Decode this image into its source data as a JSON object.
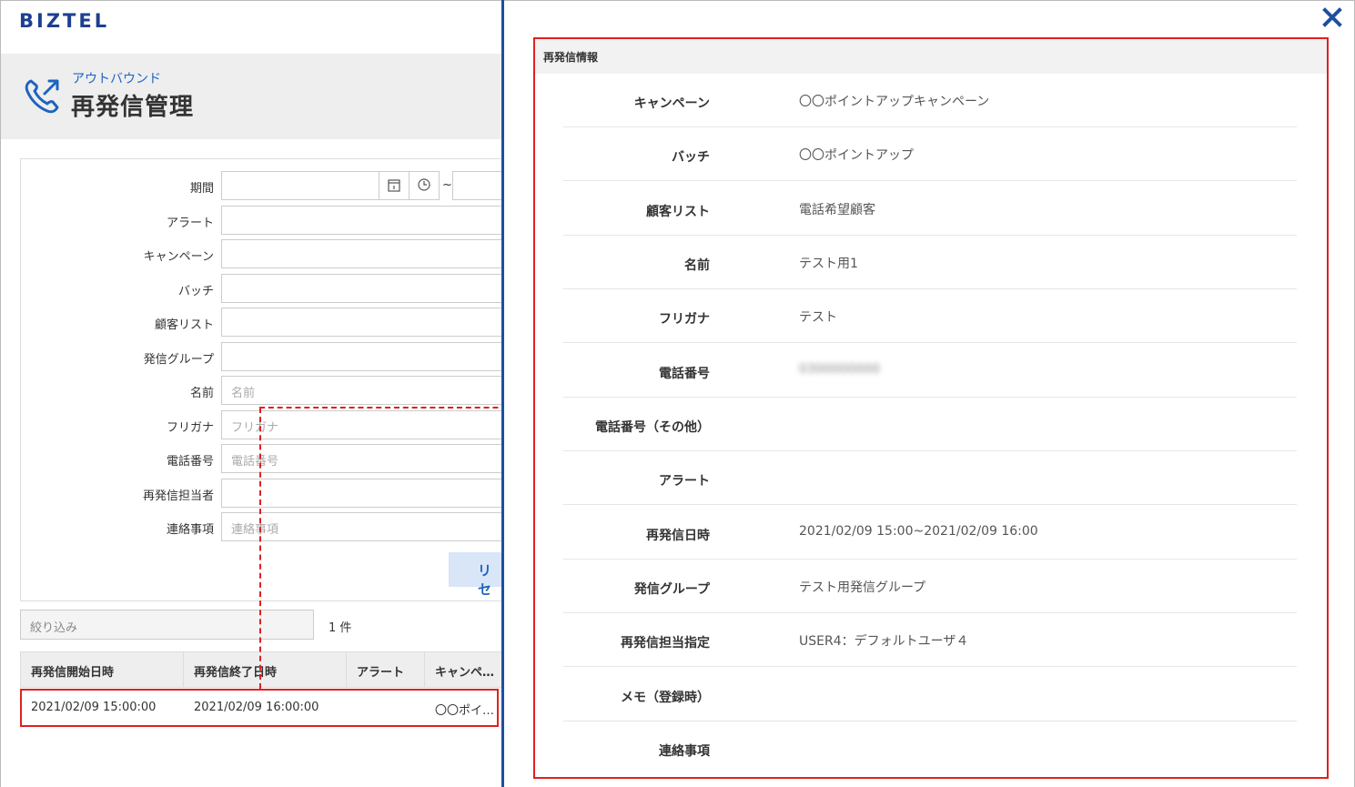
{
  "app": {
    "logo": "BIZTEL",
    "subtitle": "アウトバウンド",
    "title": "再発信管理"
  },
  "filters": {
    "rows": [
      {
        "label": "期間",
        "placeholder": ""
      },
      {
        "label": "アラート",
        "placeholder": ""
      },
      {
        "label": "キャンペーン",
        "placeholder": ""
      },
      {
        "label": "バッチ",
        "placeholder": ""
      },
      {
        "label": "顧客リスト",
        "placeholder": ""
      },
      {
        "label": "発信グループ",
        "placeholder": ""
      },
      {
        "label": "名前",
        "placeholder": "名前"
      },
      {
        "label": "フリガナ",
        "placeholder": "フリガナ"
      },
      {
        "label": "電話番号",
        "placeholder": "電話番号"
      },
      {
        "label": "再発信担当者",
        "placeholder": ""
      },
      {
        "label": "連絡事項",
        "placeholder": "連絡事項"
      }
    ],
    "tilde": "~",
    "reset_label": "リセ"
  },
  "list": {
    "narrow_placeholder": "絞り込み",
    "count": "1 件",
    "columns": [
      "再発信開始日時",
      "再発信終了日時",
      "アラート",
      "キャンペ…"
    ],
    "rows": [
      {
        "start": "2021/02/09 15:00:00",
        "end": "2021/02/09 16:00:00",
        "alert": "",
        "campaign": "〇〇ポイ…"
      }
    ]
  },
  "detail": {
    "heading": "再発信情報",
    "close_icon": "close-icon",
    "fields": [
      {
        "label": "キャンペーン",
        "value": "〇〇ポイントアップキャンペーン"
      },
      {
        "label": "バッチ",
        "value": "〇〇ポイントアップ"
      },
      {
        "label": "顧客リスト",
        "value": "電話希望顧客"
      },
      {
        "label": "名前",
        "value": "テスト用1"
      },
      {
        "label": "フリガナ",
        "value": "テスト"
      },
      {
        "label": "電話番号",
        "value": "0300000000"
      },
      {
        "label": "電話番号（その他）",
        "value": ""
      },
      {
        "label": "アラート",
        "value": ""
      },
      {
        "label": "再発信日時",
        "value": "2021/02/09 15:00~2021/02/09 16:00"
      },
      {
        "label": "発信グループ",
        "value": "テスト用発信グループ"
      },
      {
        "label": "再発信担当指定",
        "value": "USER4：デフォルトユーザ４"
      },
      {
        "label": "メモ（登録時）",
        "value": ""
      },
      {
        "label": "連絡事項",
        "value": ""
      }
    ]
  },
  "colors": {
    "brand": "#1d3f8f",
    "accent": "#1d63c0",
    "highlight": "#e02020"
  }
}
